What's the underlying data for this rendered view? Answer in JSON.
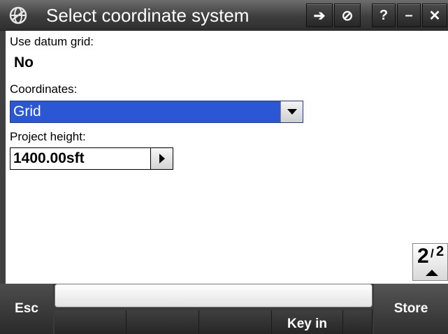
{
  "window": {
    "title": "Select coordinate system",
    "icon": "trimble-globe-icon",
    "buttons": [
      {
        "name": "login-arrow-icon",
        "glyph": "➔"
      },
      {
        "name": "no-entry-icon",
        "glyph": "⊘"
      },
      {
        "name": "help-button",
        "glyph": "?"
      },
      {
        "name": "minimize-button",
        "glyph": "–"
      },
      {
        "name": "close-button",
        "glyph": "✕"
      }
    ]
  },
  "form": {
    "datum_grid_label": "Use datum grid:",
    "datum_grid_value": "No",
    "coordinates_label": "Coordinates:",
    "coordinates_value": "Grid",
    "project_height_label": "Project height:",
    "project_height_value": "1400.00sft"
  },
  "pager": {
    "current": "2",
    "separator": "/",
    "total": "2"
  },
  "softkeys": {
    "esc": "Esc",
    "key_in": "Key in",
    "store": "Store"
  },
  "colors": {
    "selection": "#2b57d4",
    "titlebar": "#3e3e3e"
  }
}
